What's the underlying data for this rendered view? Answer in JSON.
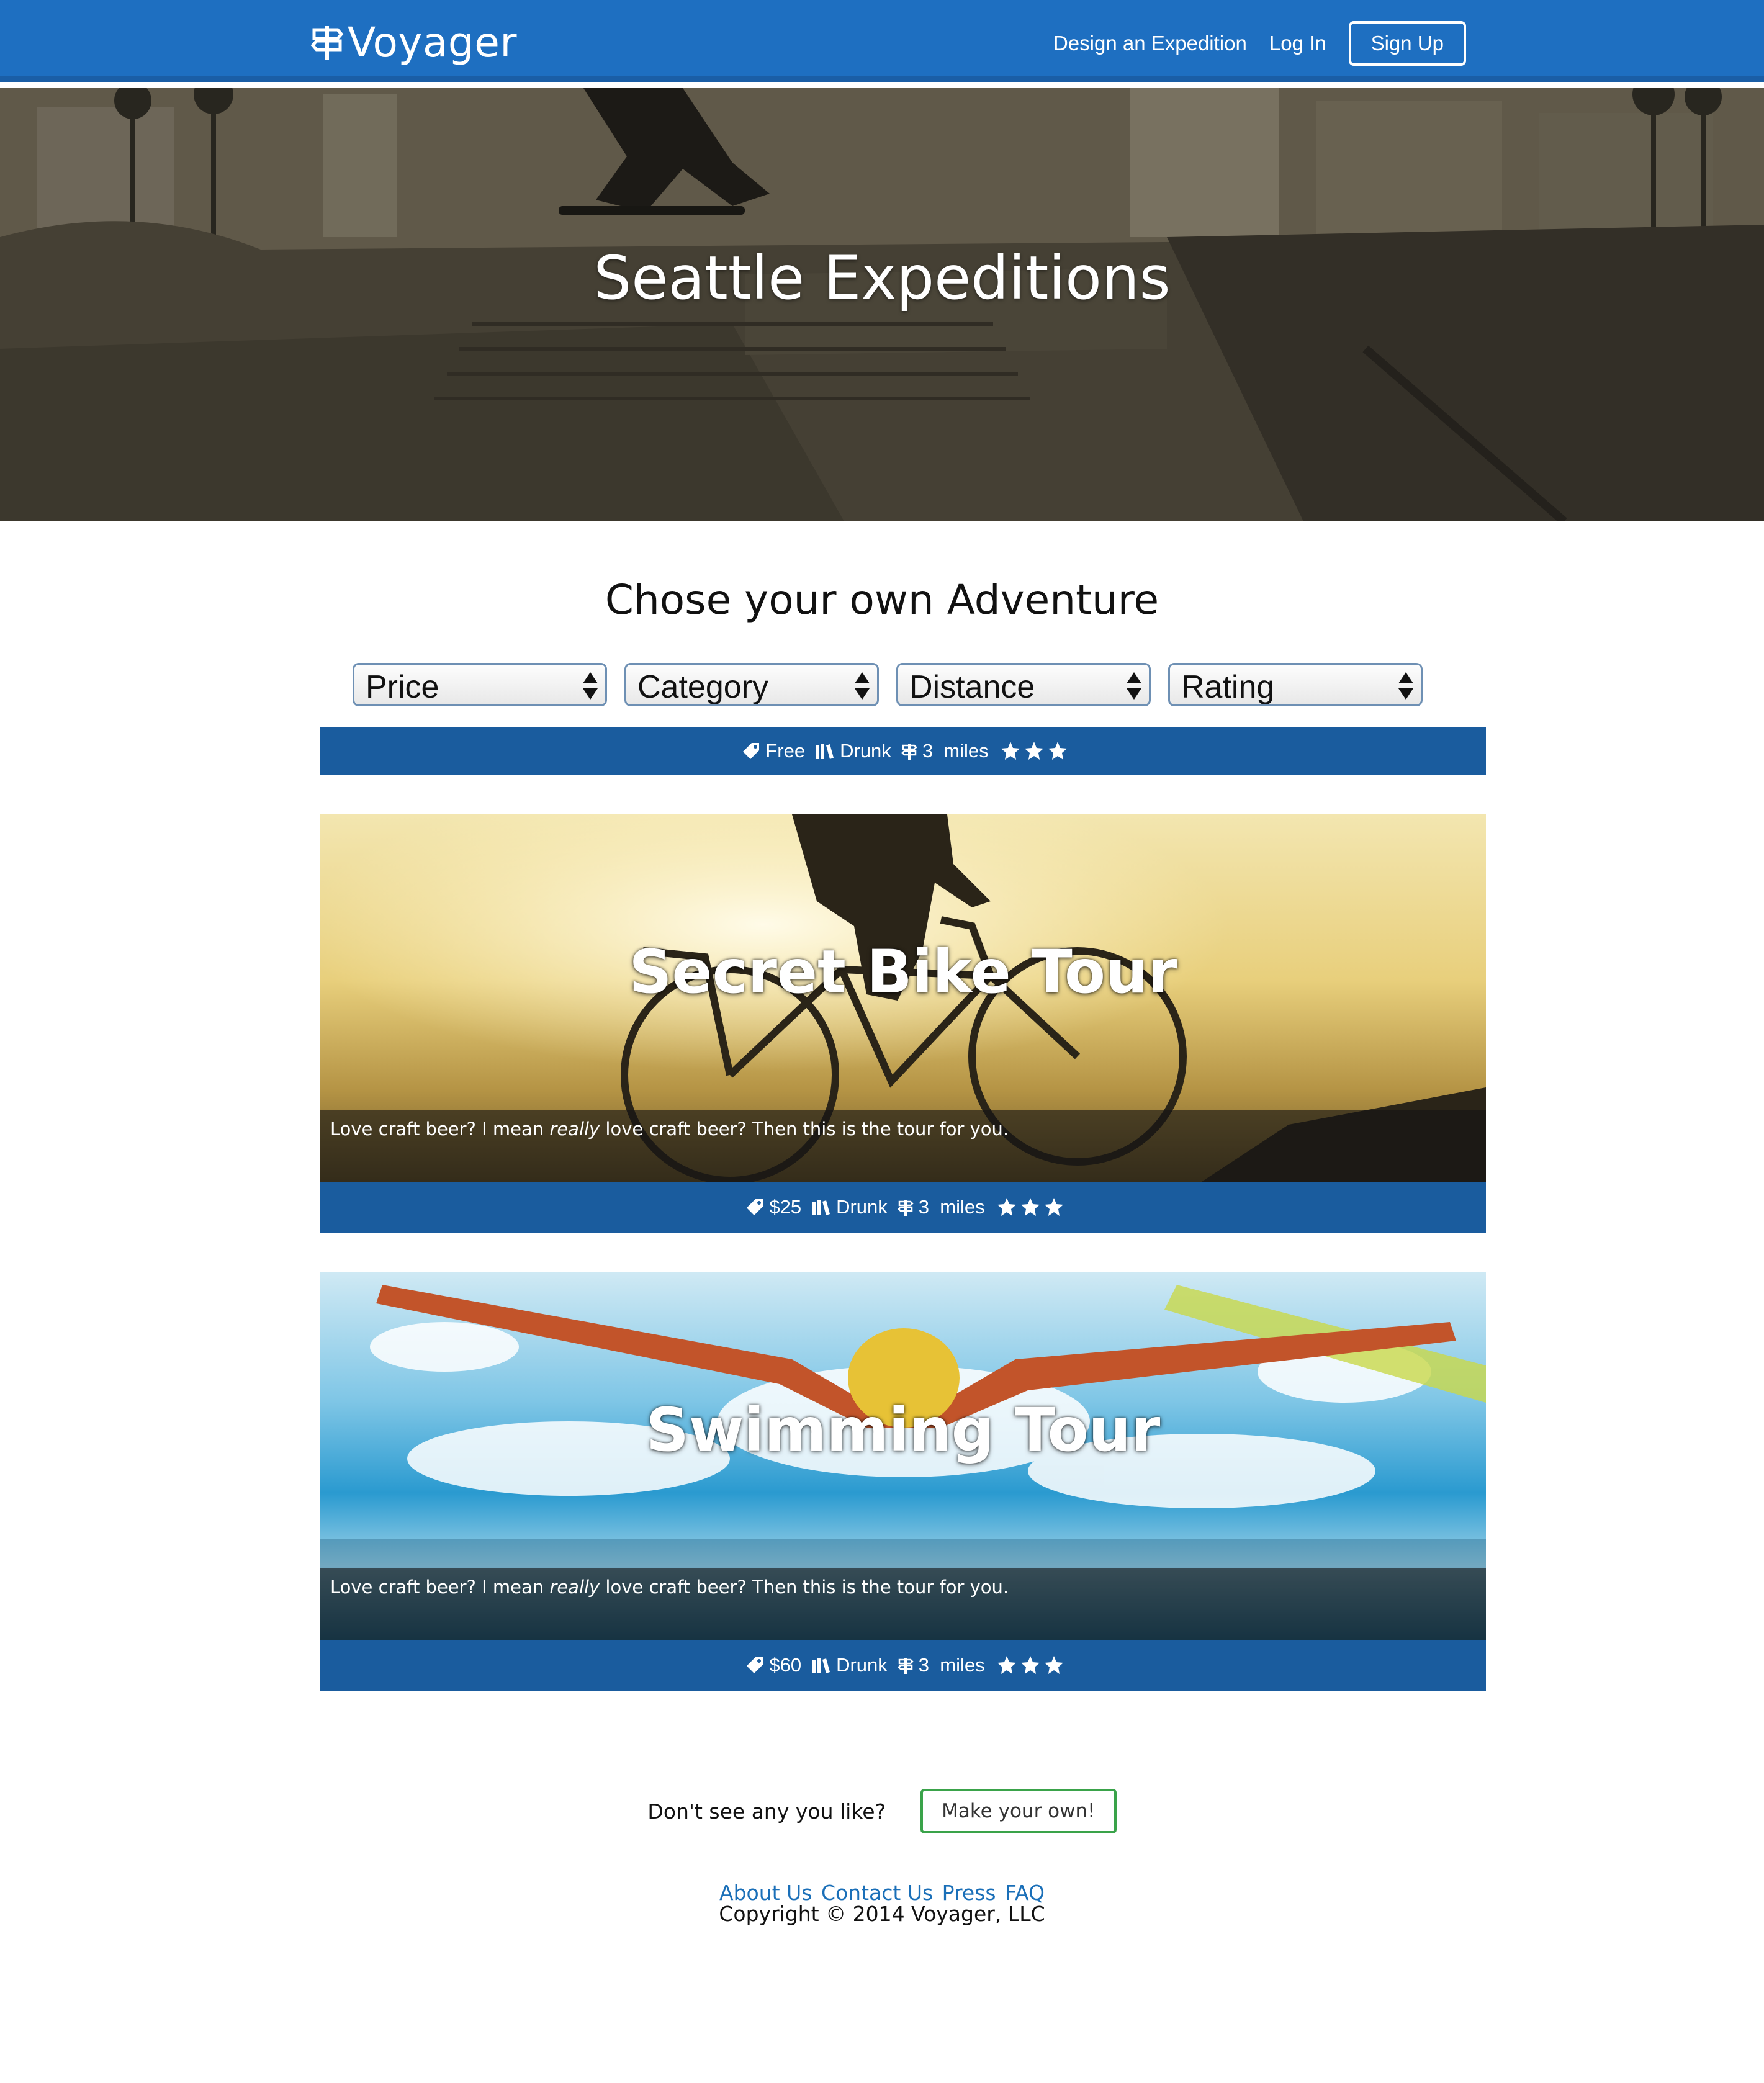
{
  "brand": {
    "name": "Voyager"
  },
  "nav": {
    "design_label": "Design an Expedition",
    "login_label": "Log In",
    "signup_label": "Sign Up"
  },
  "hero": {
    "title": "Seattle Expeditions"
  },
  "section": {
    "title": "Chose your own Adventure"
  },
  "filters": [
    {
      "label": "Price"
    },
    {
      "label": "Category"
    },
    {
      "label": "Distance"
    },
    {
      "label": "Rating"
    }
  ],
  "featured": {
    "price": "Free",
    "category": "Drunk",
    "distance_value": "3",
    "distance_unit": "miles",
    "rating": 3
  },
  "expeditions": [
    {
      "title": "Secret Bike Tour",
      "desc_before": "Love craft beer? I mean ",
      "desc_em": "really",
      "desc_after": " love craft beer? Then this is the tour for you.",
      "price": "$25",
      "category": "Drunk",
      "distance_value": "3",
      "distance_unit": "miles",
      "rating": 3
    },
    {
      "title": "Swimming Tour",
      "desc_before": "Love craft beer? I mean ",
      "desc_em": "really",
      "desc_after": " love craft beer? Then this is the tour for you.",
      "price": "$60",
      "category": "Drunk",
      "distance_value": "3",
      "distance_unit": "miles",
      "rating": 3
    }
  ],
  "cta": {
    "text": "Don't see any you like?",
    "button_label": "Make your own!"
  },
  "footer": {
    "links": [
      "About Us",
      "Contact Us",
      "Press",
      "FAQ"
    ],
    "copyright": "Copyright © 2014 Voyager, LLC"
  },
  "colors": {
    "navbar": "#1e6fc1",
    "info_bar": "#1a5c9e",
    "link": "#1a6fb8",
    "cta_border": "#3aa34a"
  },
  "icons": {
    "brand": "signpost-icon",
    "price": "tag-icon",
    "category": "books-icon",
    "distance": "signpost-icon",
    "rating": "star-icon"
  }
}
